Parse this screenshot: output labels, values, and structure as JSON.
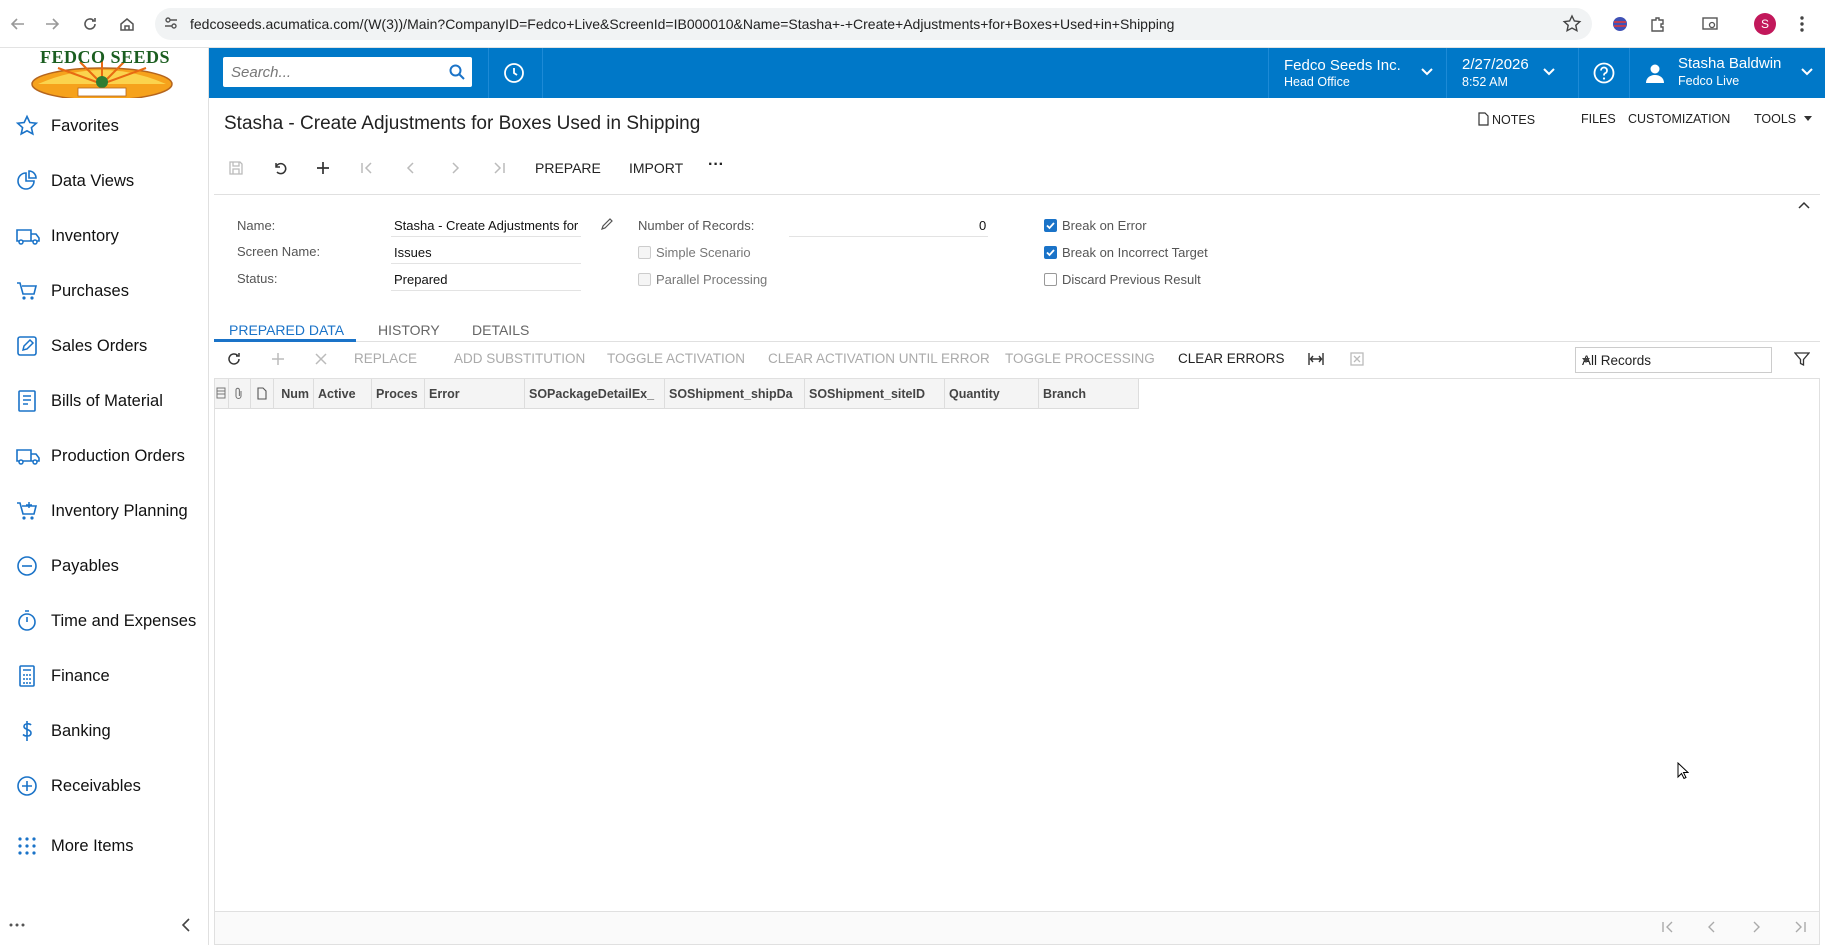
{
  "browser": {
    "url": "fedcoseeds.acumatica.com/(W(3))/Main?CompanyID=Fedco+Live&ScreenId=IB000010&Name=Stasha+-+Create+Adjustments+for+Boxes+Used+in+Shipping",
    "profile_initial": "S"
  },
  "sidebar": {
    "logo_text": "FEDCO SEEDS",
    "items": [
      {
        "label": "Favorites",
        "icon": "star-icon"
      },
      {
        "label": "Data Views",
        "icon": "pie-chart-icon"
      },
      {
        "label": "Inventory",
        "icon": "truck-icon"
      },
      {
        "label": "Purchases",
        "icon": "cart-icon"
      },
      {
        "label": "Sales Orders",
        "icon": "pencil-icon"
      },
      {
        "label": "Bills of Material",
        "icon": "document-icon"
      },
      {
        "label": "Production Orders",
        "icon": "truck-icon"
      },
      {
        "label": "Inventory Planning",
        "icon": "cart-plus-icon"
      },
      {
        "label": "Payables",
        "icon": "minus-circle-icon"
      },
      {
        "label": "Time and Expenses",
        "icon": "stopwatch-icon"
      },
      {
        "label": "Finance",
        "icon": "calculator-icon"
      },
      {
        "label": "Banking",
        "icon": "dollar-icon"
      },
      {
        "label": "Receivables",
        "icon": "plus-circle-icon"
      },
      {
        "label": "More Items",
        "icon": "grid-dots-icon"
      }
    ]
  },
  "topbar": {
    "search_placeholder": "Search...",
    "company": "Fedco Seeds Inc.",
    "branch": "Head Office",
    "date": "2/27/2026",
    "time": "8:52 AM",
    "user_name": "Stasha Baldwin",
    "user_tenant": "Fedco Live"
  },
  "page": {
    "title": "Stasha - Create Adjustments for Boxes Used in Shipping",
    "links": {
      "notes": "NOTES",
      "files": "FILES",
      "customization": "CUSTOMIZATION",
      "tools": "TOOLS"
    },
    "toolbar": {
      "prepare": "PREPARE",
      "import": "IMPORT",
      "more": "···"
    }
  },
  "form": {
    "name_label": "Name:",
    "name_value": "Stasha - Create Adjustments for",
    "screen_label": "Screen Name:",
    "screen_value": "Issues",
    "status_label": "Status:",
    "status_value": "Prepared",
    "records_label": "Number of Records:",
    "records_value": "0",
    "simple_scenario": "Simple Scenario",
    "parallel_processing": "Parallel Processing",
    "break_on_error": "Break on Error",
    "break_on_target": "Break on Incorrect Target",
    "discard_previous": "Discard Previous Result"
  },
  "tabs": [
    "PREPARED DATA",
    "HISTORY",
    "DETAILS"
  ],
  "grid_toolbar": {
    "replace": "REPLACE",
    "add_substitution": "ADD SUBSTITUTION",
    "toggle_activation": "TOGGLE ACTIVATION",
    "clear_activation": "CLEAR ACTIVATION UNTIL ERROR",
    "toggle_processing": "TOGGLE PROCESSING",
    "clear_errors": "CLEAR ERRORS",
    "records_filter": "All Records"
  },
  "grid_columns": [
    "Num",
    "Active",
    "Proces",
    "Error",
    "SOPackageDetailEx_",
    "SOShipment_shipDa",
    "SOShipment_siteID",
    "Quantity",
    "Branch"
  ]
}
